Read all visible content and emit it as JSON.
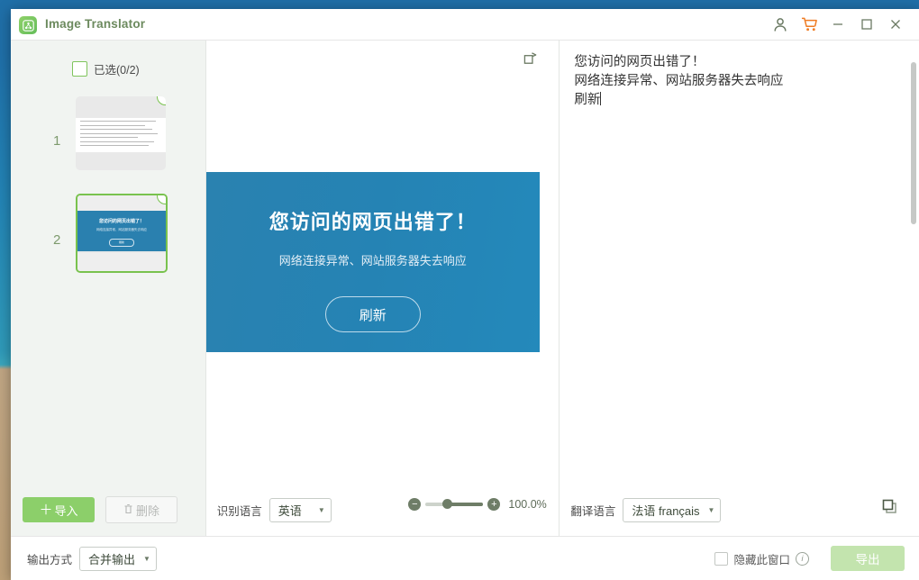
{
  "window": {
    "app_title": "Image Translator",
    "logo_icon": "image-translator-logo",
    "account_icon": "user-account-icon",
    "cart_icon": "shopping-cart-icon",
    "minimize_icon": "minimize-icon",
    "maximize_icon": "maximize-icon",
    "close_icon": "close-icon"
  },
  "sidebar": {
    "select_all_label": "已选(0/2)",
    "select_all_checked": false,
    "thumbnails": [
      {
        "index": "1",
        "kind": "document",
        "selected": false
      },
      {
        "index": "2",
        "kind": "error-page",
        "selected": true,
        "title": "您访问的网页出错了！",
        "subtitle": "网络连接异常、网站服务器失去响应",
        "button": "刷新"
      }
    ],
    "import_button": "导入",
    "import_icon": "plus-icon",
    "delete_button": "删除",
    "delete_icon": "trash-icon",
    "delete_disabled": true
  },
  "preview": {
    "tool_icon": "rotate-crop-icon",
    "image": {
      "title": "您访问的网页出错了！",
      "subtitle": "网络连接异常、网站服务器失去响应",
      "button": "刷新"
    },
    "recognize_label": "识别语言",
    "recognize_value": "英语",
    "zoom_out_icon": "minus-circle-icon",
    "zoom_in_icon": "plus-circle-icon",
    "zoom_value": "100.0%",
    "zoom_percent": 40
  },
  "translation": {
    "text": "您访问的网页出错了！\n网络连接异常、网站服务器失去响应\n刷新",
    "translate_label": "翻译语言",
    "translate_value": "法语 français",
    "copy_icon": "copy-icon"
  },
  "statusbar": {
    "output_label": "输出方式",
    "output_value": "合并输出",
    "hide_window_label": "隐藏此窗口",
    "hide_window_checked": false,
    "info_icon": "info-icon",
    "info_glyph": "i",
    "export_button": "导出",
    "export_disabled": true
  },
  "colors": {
    "brand_green": "#8ccf6a",
    "accent_orange": "#ef7c24",
    "image_blue": "#2583b4",
    "title_text": "#6c8a5e"
  }
}
